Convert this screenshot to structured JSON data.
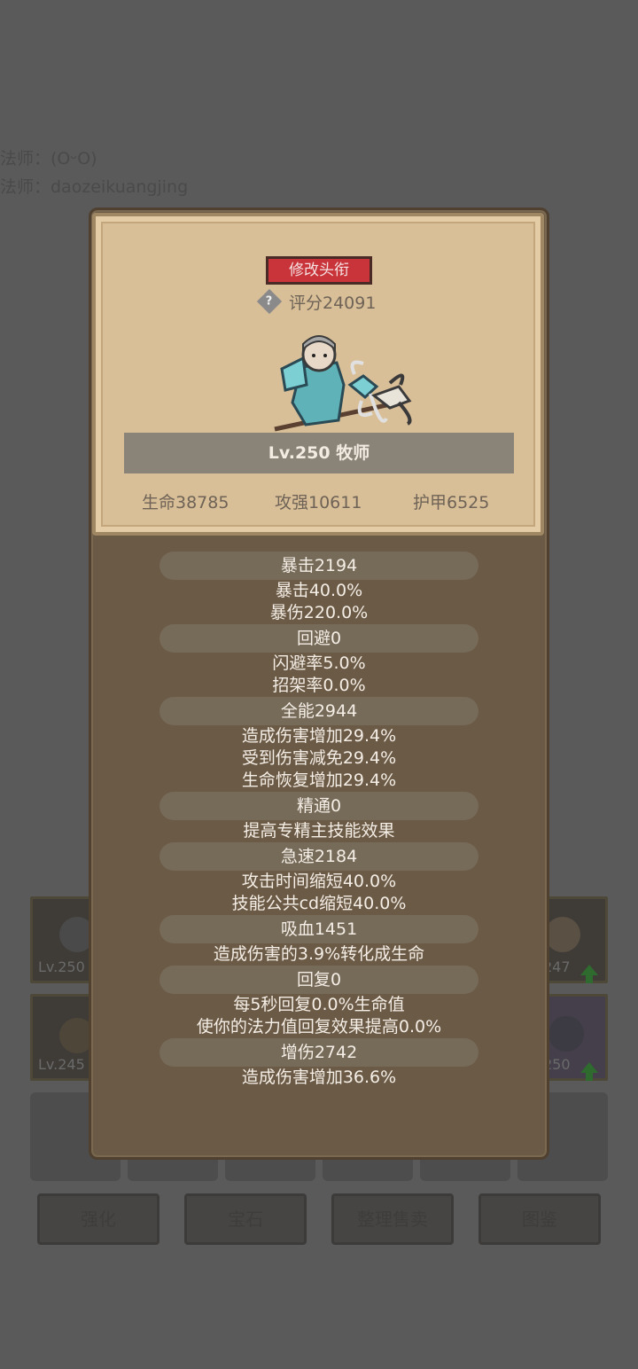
{
  "background": {
    "line1": "法师：(OᵕO)",
    "line2": "法师：daozeikuangjing",
    "slots": [
      {
        "level": "Lv.250"
      },
      {
        "level": "247"
      },
      {
        "level": "Lv.245"
      },
      {
        "level": "250"
      }
    ],
    "bottom_buttons": [
      "强化",
      "宝石",
      "整理售卖",
      "图鉴"
    ]
  },
  "profile": {
    "edit_title_label": "修改头衔",
    "score": "评分24091",
    "level_class": "Lv.250 牧师",
    "hp": "生命38785",
    "attack": "攻强10611",
    "armor": "护甲6525"
  },
  "attributes": [
    {
      "name": "暴击2194",
      "effects": [
        "暴击40.0%",
        "暴伤220.0%"
      ]
    },
    {
      "name": "回避0",
      "effects": [
        "闪避率5.0%",
        "招架率0.0%"
      ]
    },
    {
      "name": "全能2944",
      "effects": [
        "造成伤害增加29.4%",
        "受到伤害减免29.4%",
        "生命恢复增加29.4%"
      ]
    },
    {
      "name": "精通0",
      "effects": [
        "提高专精主技能效果"
      ]
    },
    {
      "name": "急速2184",
      "effects": [
        "攻击时间缩短40.0%",
        "技能公共cd缩短40.0%"
      ]
    },
    {
      "name": "吸血1451",
      "effects": [
        "造成伤害的3.9%转化成生命"
      ]
    },
    {
      "name": "回复0",
      "effects": [
        "每5秒回复0.0%生命值",
        "使你的法力值回复效果提高0.0%"
      ]
    },
    {
      "name": "增伤2742",
      "effects": [
        "造成伤害增加36.6%"
      ]
    }
  ]
}
